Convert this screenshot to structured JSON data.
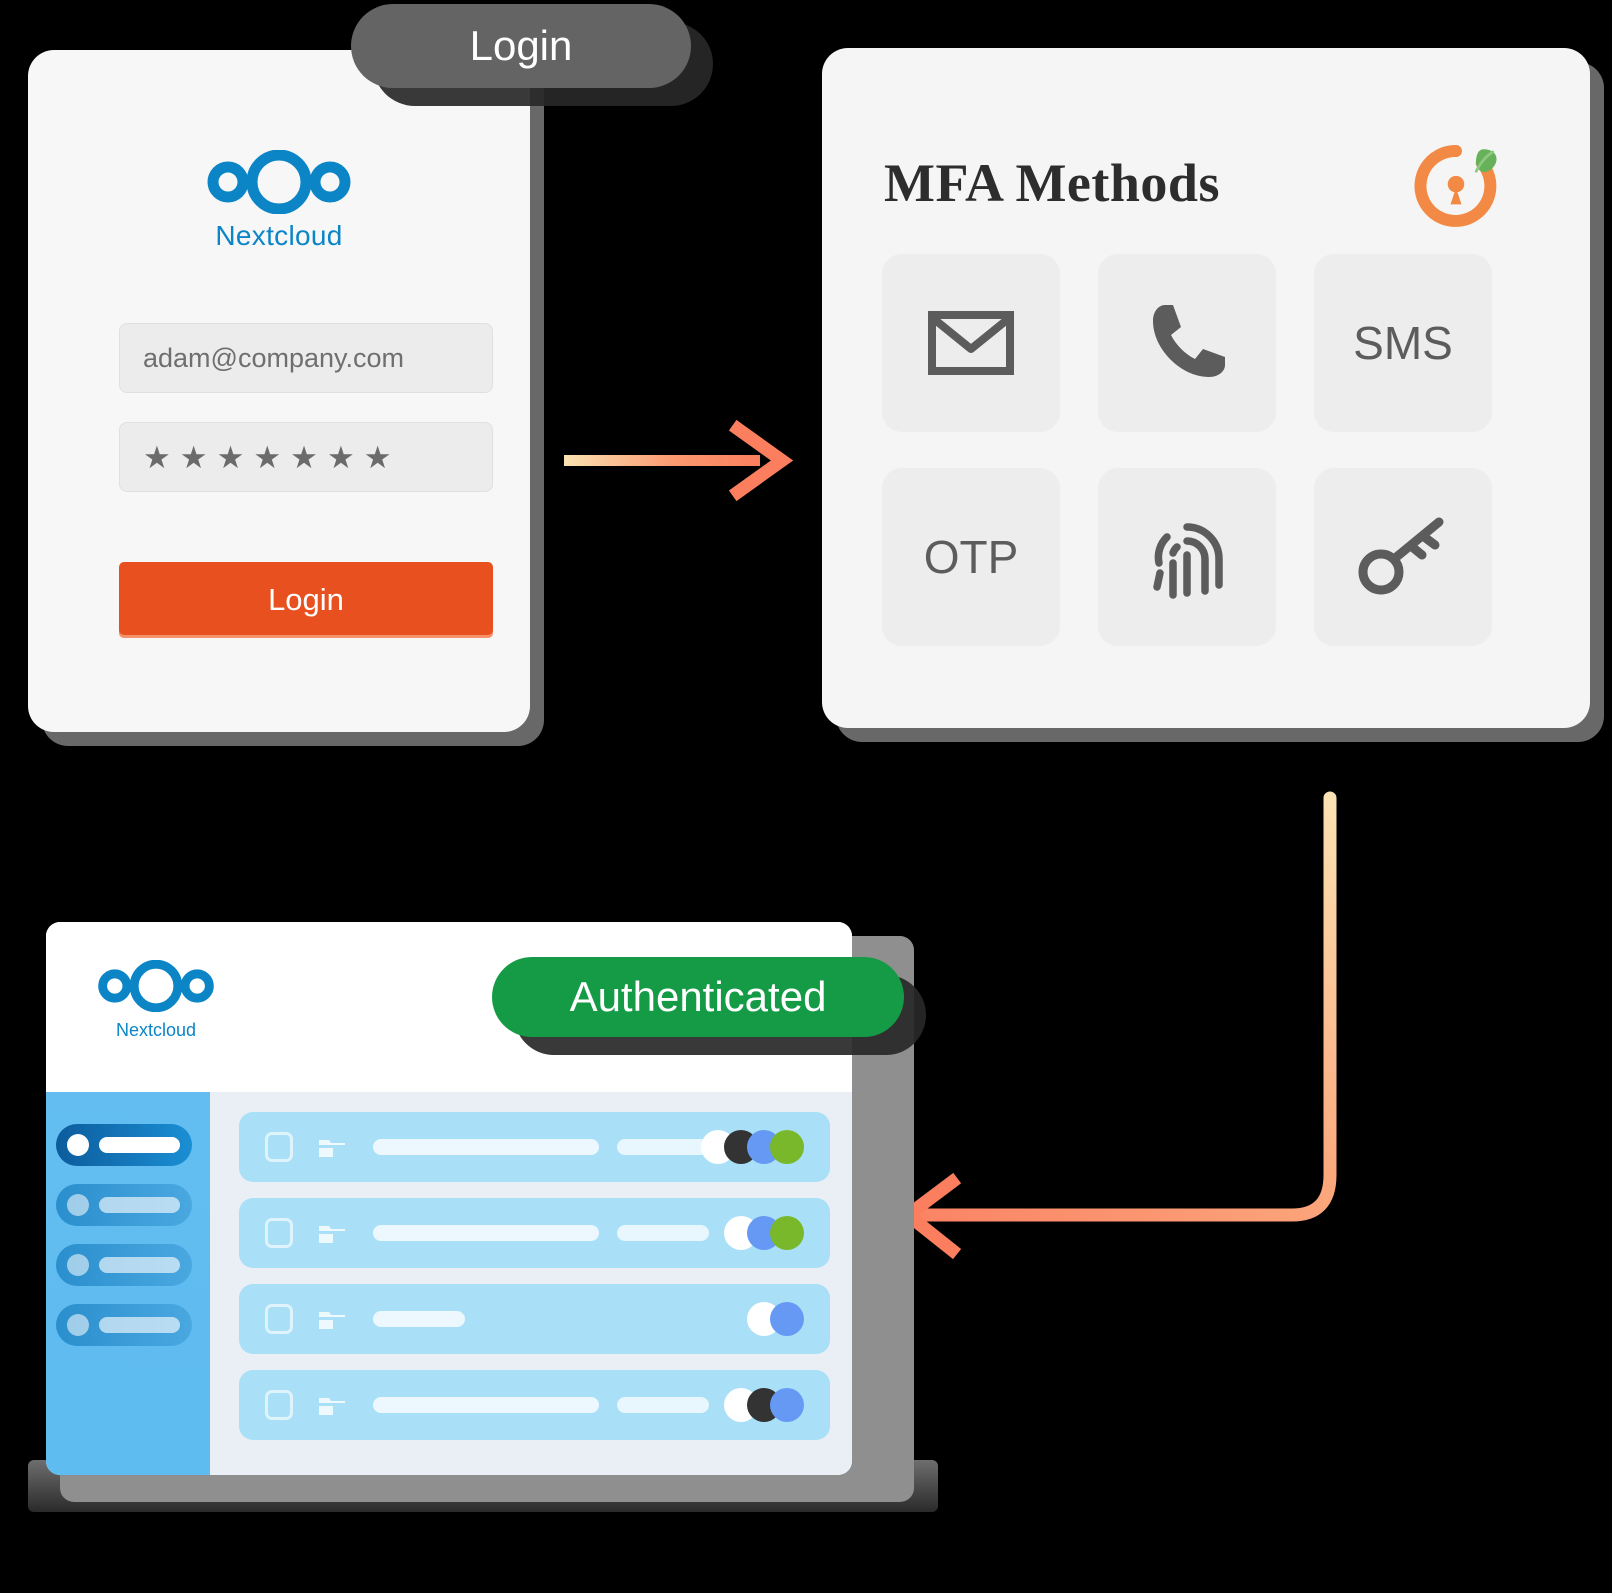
{
  "flow": {
    "step1_badge": "Login",
    "step3_badge": "Authenticated"
  },
  "login_card": {
    "brand_name": "Nextcloud",
    "brand_color": "#0b85c6",
    "email_value": "adam@company.com",
    "email_placeholder": "adam@company.com",
    "password_mask": "★★★★★★★",
    "password_char_count": 7,
    "submit_label": "Login",
    "submit_color": "#e8511f"
  },
  "mfa_panel": {
    "title": "MFA Methods",
    "logo_name": "lock-timer-leaf-logo",
    "logo_colors": {
      "ring": "#f28a45",
      "leaf": "#67b15a"
    },
    "methods": [
      {
        "id": "email",
        "label": "",
        "icon": "envelope-icon"
      },
      {
        "id": "phone-call",
        "label": "",
        "icon": "phone-icon"
      },
      {
        "id": "sms",
        "label": "SMS",
        "icon": "text-label"
      },
      {
        "id": "otp",
        "label": "OTP",
        "icon": "text-label"
      },
      {
        "id": "biometric",
        "label": "",
        "icon": "fingerprint-icon"
      },
      {
        "id": "security-key",
        "label": "",
        "icon": "key-icon"
      }
    ]
  },
  "dashboard": {
    "brand_name": "Nextcloud",
    "status_badge": "Authenticated",
    "status_color": "#159a46",
    "sidebar_items": [
      {
        "id": "nav-1",
        "active": true
      },
      {
        "id": "nav-2",
        "active": false
      },
      {
        "id": "nav-3",
        "active": false
      },
      {
        "id": "nav-4",
        "active": false
      }
    ],
    "file_rows": [
      {
        "name_width": 226,
        "meta_width": 92,
        "avatars": [
          "#ffffff",
          "#333333",
          "#6699f3",
          "#78b82a"
        ]
      },
      {
        "name_width": 226,
        "meta_width": 92,
        "avatars": [
          "#ffffff",
          "#6699f3",
          "#78b82a"
        ]
      },
      {
        "name_width": 92,
        "meta_width": 0,
        "avatars": [
          "#ffffff",
          "#6699f3"
        ]
      },
      {
        "name_width": 226,
        "meta_width": 92,
        "avatars": [
          "#ffffff",
          "#333333",
          "#6699f3"
        ]
      }
    ]
  },
  "arrows": {
    "arrow_1_direction": "right",
    "arrow_2_direction": "down-then-left",
    "gradient_from": "#fbe2b2",
    "gradient_to": "#fb8465"
  }
}
